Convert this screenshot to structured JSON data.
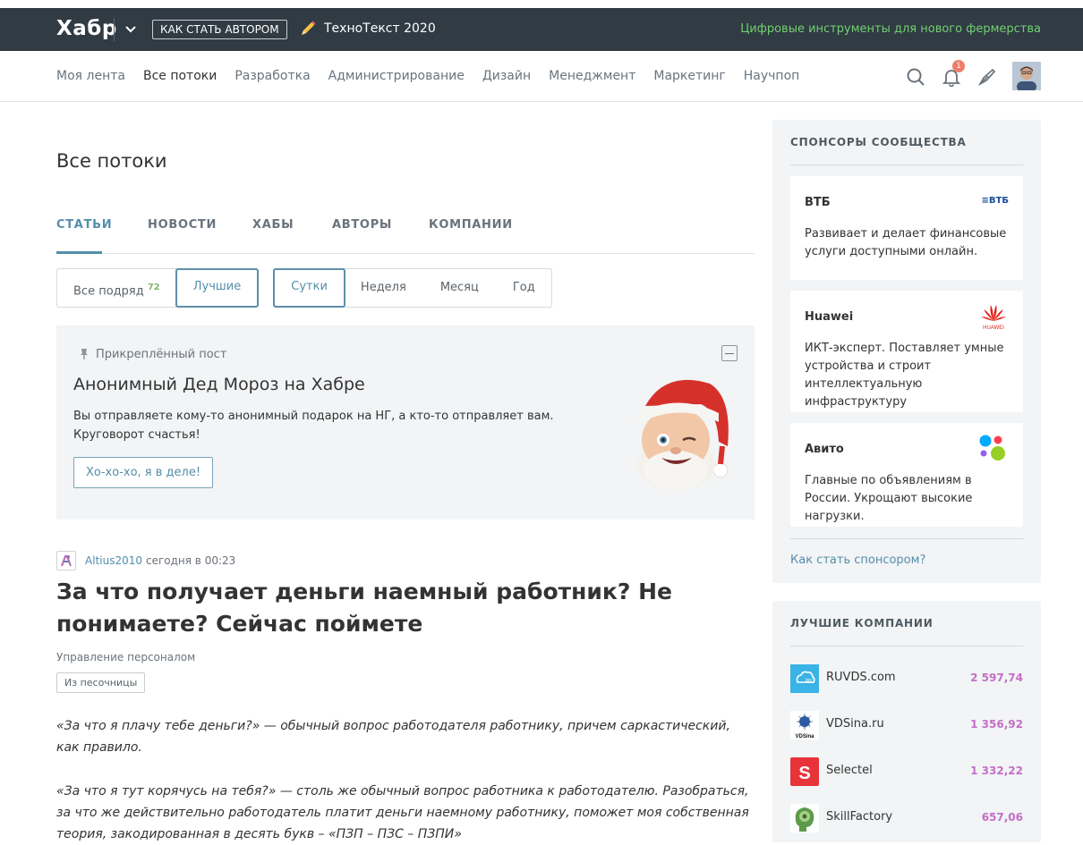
{
  "topbar": {
    "logo": "Хабр",
    "author_button": "КАК СТАТЬ АВТОРОМ",
    "event": "ТехноТекст 2020",
    "promo": "Цифровые инструменты для нового фермерства"
  },
  "nav": {
    "items": [
      {
        "label": "Моя лента"
      },
      {
        "label": "Все потоки"
      },
      {
        "label": "Разработка"
      },
      {
        "label": "Администрирование"
      },
      {
        "label": "Дизайн"
      },
      {
        "label": "Менеджмент"
      },
      {
        "label": "Маркетинг"
      },
      {
        "label": "Научпоп"
      }
    ],
    "active": "Все потоки",
    "notifications_count": "1"
  },
  "page": {
    "title": "Все потоки",
    "tabs": [
      "СТАТЬИ",
      "НОВОСТИ",
      "ХАБЫ",
      "АВТОРЫ",
      "КОМПАНИИ"
    ],
    "active_tab": "СТАТЬИ"
  },
  "filters": {
    "all_label": "Все подряд",
    "all_count": "72",
    "best_label": "Лучшие",
    "periods": [
      "Сутки",
      "Неделя",
      "Месяц",
      "Год"
    ],
    "selected_period": "Сутки"
  },
  "pinned": {
    "label": "Прикреплённый пост",
    "title": "Анонимный Дед Мороз на Хабре",
    "text": "Вы отправляете кому-то анонимный подарок на НГ, а кто-то отправляет вам. Круговорот счастья!",
    "button": "Хо-хо-хо, я в деле!"
  },
  "post": {
    "author": "Altius2010",
    "date": "сегодня в 00:23",
    "title": "За что получает деньги наемный работник? Не понимаете? Сейчас поймете",
    "hub": "Управление персоналом",
    "tag": "Из песочницы",
    "p1": "«За что я плачу тебе деньги?» — обычный вопрос работодателя работнику, причем саркастический, как правило.",
    "p2": "«За что я тут корячусь на тебя?» — столь же обычный вопрос работника к работодателю. Разобраться, за что же действительно работодатель платит деньги наемному работнику, поможет моя собственная теория, закодированная в десять букв – «ПЗП – ПЗС – ПЗПИ»"
  },
  "sponsors": {
    "heading": "СПОНСОРЫ СООБЩЕСТВА",
    "items": [
      {
        "name": "ВТБ",
        "desc": "Развивает и делает финансовые услуги доступными онлайн.",
        "logo_text": "ВТБ"
      },
      {
        "name": "Huawei",
        "desc": "ИКТ-эксперт. Поставляет умные устройства и строит интеллектуальную инфраструктуру",
        "logo_text": "HUAWEI"
      },
      {
        "name": "Авито",
        "desc": "Главные по объявлениям в России. Укрощают высокие нагрузки."
      }
    ],
    "link": "Как стать спонсором?"
  },
  "companies": {
    "heading": "ЛУЧШИЕ КОМПАНИИ",
    "items": [
      {
        "name": "RUVDS.com",
        "rating": "2 597,74",
        "logo_text": "RU"
      },
      {
        "name": "VDSina.ru",
        "rating": "1 356,92",
        "logo_text": "VDSina"
      },
      {
        "name": "Selectel",
        "rating": "1 332,22",
        "logo_text": "S"
      },
      {
        "name": "SkillFactory",
        "rating": "657,06"
      }
    ]
  },
  "colors": {
    "topbar_bg": "#303b44",
    "accent": "#548eaa",
    "promo": "#72d070",
    "rating": "#c56ec6"
  }
}
